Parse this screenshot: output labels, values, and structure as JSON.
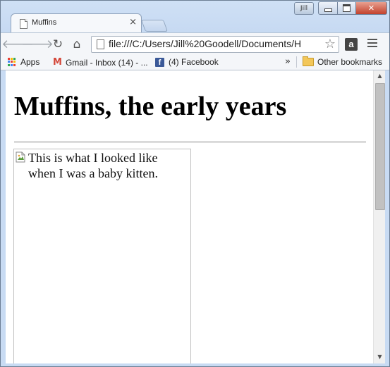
{
  "window": {
    "user_badge": "Jill",
    "controls": {
      "close_glyph": "✕"
    }
  },
  "tab": {
    "title": "Muffins",
    "close_glyph": "×"
  },
  "toolbar": {
    "back_icon": "arrow-left-icon",
    "forward_icon": "arrow-right-icon",
    "reload_icon": "reload-icon",
    "home_icon": "home-icon",
    "url": "file:///C:/Users/Jill%20Goodell/Documents/H",
    "extension_label": "a"
  },
  "bookmarks": {
    "items": [
      {
        "label": "Apps"
      },
      {
        "label": "Gmail - Inbox (14) - ..."
      },
      {
        "label": "(4) Facebook"
      }
    ],
    "overflow": "»",
    "other": "Other bookmarks"
  },
  "page": {
    "heading": "Muffins, the early years",
    "image_alt": "This is what I looked like when I was a baby kitten."
  },
  "colors": {
    "frame": "#c8dbf3",
    "gmail_red": "#d44638",
    "facebook_blue": "#3b5998",
    "folder_yellow": "#f3c75a"
  }
}
